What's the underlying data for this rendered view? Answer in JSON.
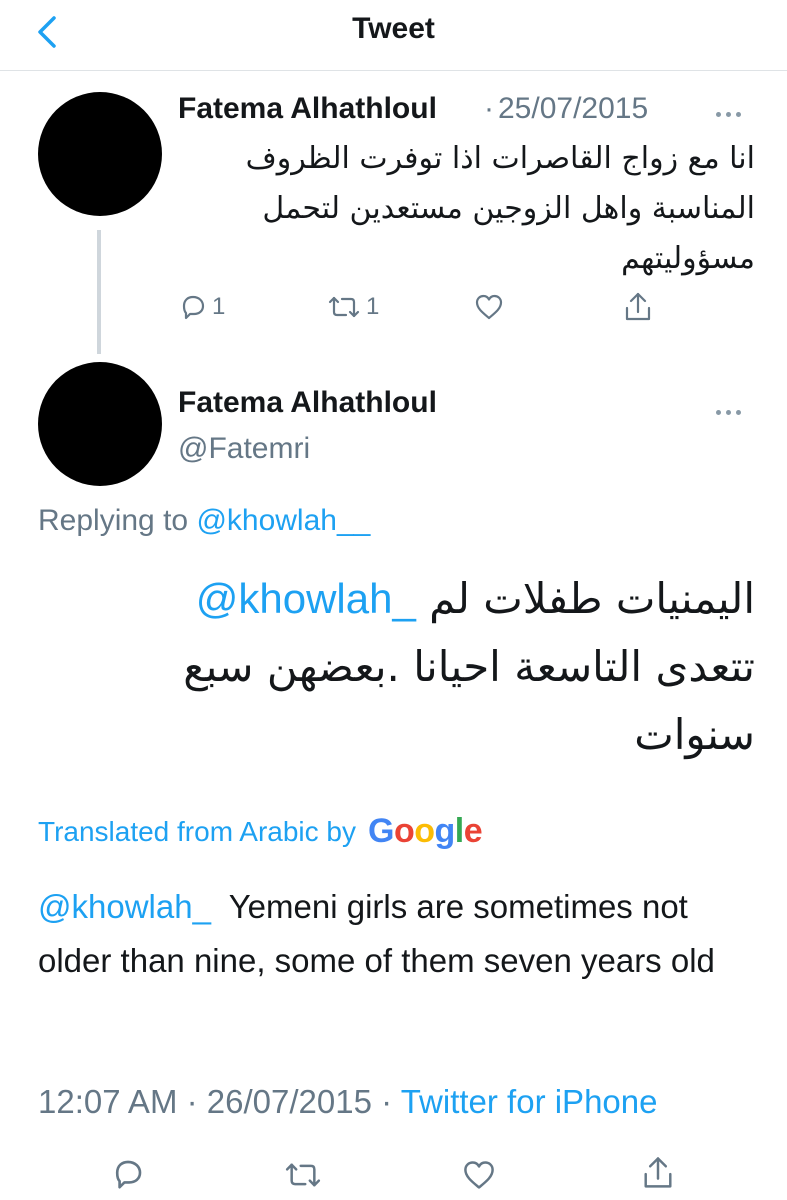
{
  "header": {
    "title": "Tweet",
    "back_icon": "chevron-left-icon"
  },
  "colors": {
    "accent": "#1da1f2",
    "muted": "#657786",
    "text": "#14171a",
    "avatar": "#000000"
  },
  "parent_tweet": {
    "author": "Fatema Alhathloul",
    "separator": "·",
    "date": "25/07/2015",
    "text_lines": [
      "انا مع زواج القاصرات اذا توفرت الظروف",
      "المناسبة واهل الزوجين مستعدين لتحمل",
      "مسؤوليتهم"
    ],
    "reply_count": "1",
    "retweet_count": "1"
  },
  "main_tweet": {
    "author": "Fatema Alhathloul",
    "handle": "@Fatemri",
    "replying_prefix": "Replying to",
    "replying_to": "@khowlah__",
    "mention": "@khowlah_",
    "text_line1": "اليمنيات طفلات لم",
    "text_line2": "تتعدى التاسعة احيانا .بعضهن سبع",
    "text_line3": "سنوات",
    "translated_label": "Translated from Arabic by",
    "translation_mention": "@khowlah_",
    "translation_text": "Yemeni girls are sometimes not older than nine, some of them seven years old",
    "time": "12:07 AM",
    "date": "26/07/2015",
    "separator": "·",
    "source": "Twitter for iPhone"
  }
}
